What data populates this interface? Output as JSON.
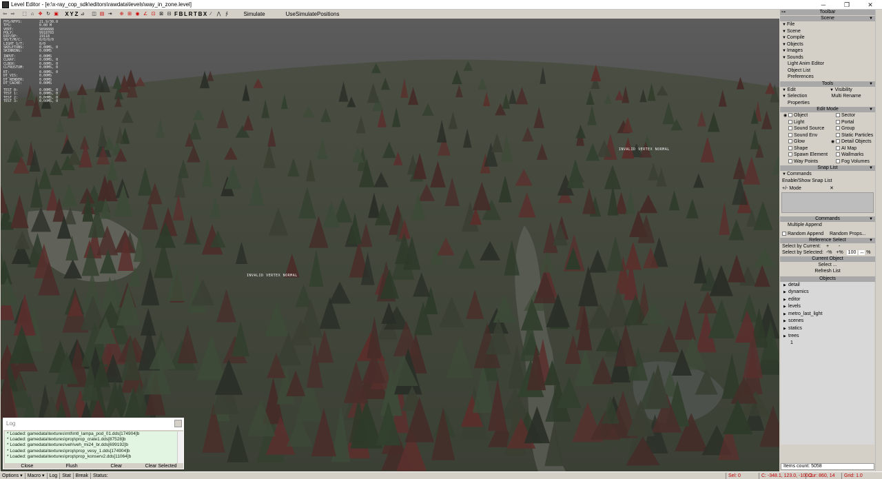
{
  "window": {
    "title": "Level Editor - [e:\\x-ray_cop_sdk\\editors\\rawdata\\levels\\way_in_zone.level]",
    "minimize_glyph": "─",
    "maximize_glyph": "❐",
    "close_glyph": "✕"
  },
  "toolbar": {
    "axis_x": "X",
    "axis_y": "Y",
    "axis_z": "Z",
    "view_letters": [
      "F",
      "B",
      "L",
      "R",
      "T",
      "B",
      "X"
    ],
    "simulate_label": "Simulate",
    "use_sim_label": "UseSimulatePositions"
  },
  "stats": {
    "group1": [
      {
        "k": "FPS/RFPS:",
        "v": "21.9/30.0"
      },
      {
        "k": "TPS:",
        "v": "0.00 M"
      },
      {
        "k": "VERT:",
        "v": "9898888"
      },
      {
        "k": "POLY:",
        "v": "9918703"
      },
      {
        "k": "DIP/DP:",
        "v": "19118"
      },
      {
        "k": "SH/T/M/C:",
        "v": "0/0/0/0"
      },
      {
        "k": "LIGHT S/T:",
        "v": "0/0"
      },
      {
        "k": "SKELETONS:",
        "v": "0.00MS, 0"
      },
      {
        "k": "SKINNING:",
        "v": "0.00MS"
      }
    ],
    "group2": [
      {
        "k": "INPUT:",
        "v": "0.00MS"
      },
      {
        "k": "CLRAY:",
        "v": "0.00MS, 0"
      },
      {
        "k": "CLBOX:",
        "v": "0.00MS, 0"
      },
      {
        "k": "CLFRUSTUM:",
        "v": "0.00MS, 0"
      }
    ],
    "group3": [
      {
        "k": "RT:",
        "v": "0.00MS, 0"
      },
      {
        "k": "DT_VIS:",
        "v": "0.00MS"
      },
      {
        "k": "DT_RENDER:",
        "v": "0.00MS"
      },
      {
        "k": "DT_CACHE:",
        "v": "0.00MS"
      }
    ],
    "group4": [
      {
        "k": "TEST 0:",
        "v": "0.00MS, 0"
      },
      {
        "k": "TEST 1:",
        "v": "0.00MS, 0"
      },
      {
        "k": "TEST 2:",
        "v": "0.00MS, 0"
      },
      {
        "k": "TEST 3:",
        "v": "0.00MS, 0"
      }
    ]
  },
  "viewport_labels": {
    "invalid_vertex_1": "INVALID VERTEX NORMAL",
    "invalid_vertex_2": "INVALID VERTEX NORMAL"
  },
  "log": {
    "title": "Log",
    "lines": [
      "* Loaded: gamedata\\textures\\mtl\\mtl_lampa_pod_01.dds[174904]b",
      "* Loaded: gamedata\\textures\\prop\\prop_crate1.dds[87528]b",
      "* Loaded: gamedata\\textures\\veh\\veh_mi24_br.dds[699192]b",
      "* Loaded: gamedata\\textures\\prop\\prop_vesy_1.dds[174904]b",
      "* Loaded: gamedata\\textures\\prop\\prop_konserv2.dds[11064]b"
    ],
    "buttons": [
      "Close",
      "Flush",
      "Clear",
      "Clear Selected"
    ]
  },
  "panel": {
    "toolbar_header": "Toolbar",
    "scene_header": "Scene",
    "scene_items": [
      "File",
      "Scene",
      "Compile",
      "Objects",
      "Images",
      "Sounds"
    ],
    "scene_plain": [
      "Light Anim Editor",
      "Object List",
      "Preferences"
    ],
    "tools_header": "Tools",
    "tools_edit": "Edit",
    "tools_visibility": "Visibility",
    "tools_selection": "Selection",
    "tools_multi_rename": "Multi Rename",
    "tools_properties": "Properties",
    "edit_mode_header": "Edit Mode",
    "edit_mode": [
      [
        "Object",
        "Sector"
      ],
      [
        "Light",
        "Portal"
      ],
      [
        "Sound Source",
        "Group"
      ],
      [
        "Sound Env",
        "Static Particles"
      ],
      [
        "Glow",
        "Detail Objects"
      ],
      [
        "Shape",
        "AI Map"
      ],
      [
        "Spawn Element",
        "Wallmarks"
      ],
      [
        "Way Points",
        "Fog Volumes"
      ]
    ],
    "snap_header": "Snap List",
    "snap_commands": "Commands",
    "snap_enable": "Enable/Show Snap List",
    "snap_mode": "Mode",
    "snap_mode_icon": "+/-",
    "snap_close": "✕",
    "commands_header": "Commands",
    "multiple_append": "Multiple Append",
    "random_append": "Random Append",
    "random_props": "Random Props...",
    "ref_header": "Reference Select",
    "select_by_current": "Select by Current:",
    "plus": "+",
    "minus": "-",
    "select_by_selected": "Select by Selected:",
    "minus_pct": "-%",
    "plus_pct": "+%",
    "percent_value": "100",
    "arrows": "↔",
    "pct": "%",
    "current_header": "Current Object",
    "select_btn": "Select ...",
    "refresh_btn": "Refresh List",
    "objects_header": "Objects",
    "objects": [
      "detail",
      "dynamics",
      "editor",
      "levels",
      "metro_last_light",
      "scenes",
      "statics",
      "trees"
    ],
    "objects_sub": "1",
    "items_count": "Items count: 5058"
  },
  "status": {
    "options": "Options",
    "macro": "Macro",
    "log": "Log",
    "stat": "Stat",
    "break": "Break",
    "status": "Status:",
    "sel": "Sel: 0",
    "coords": "C: -348.1, 123.0, -100.2",
    "cur": "Cur: 860, 14",
    "grid": "Grid: 1.0"
  },
  "colors": {
    "sky": "#5c5c5c",
    "status_red": "#c00000",
    "log_bg": "#e2f4e2",
    "panel_header": "#a8a8a8"
  }
}
